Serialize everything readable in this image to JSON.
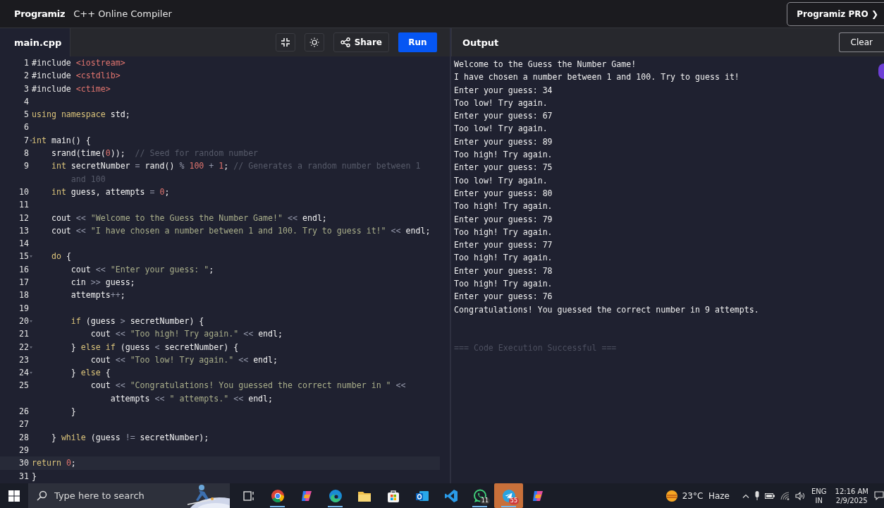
{
  "header": {
    "logo": "Programiz",
    "title": "C++ Online Compiler",
    "pro_button": "Programiz PRO ❯"
  },
  "editor": {
    "file_tab": "main.cpp",
    "share_button": "Share",
    "run_button": "Run",
    "lines": [
      {
        "n": "1",
        "fold": false,
        "active": false,
        "tokens": [
          {
            "kind": "pp",
            "text": "#include "
          },
          {
            "kind": "hdr",
            "text": "<iostream>"
          }
        ]
      },
      {
        "n": "2",
        "fold": false,
        "active": false,
        "tokens": [
          {
            "kind": "pp",
            "text": "#include "
          },
          {
            "kind": "hdr",
            "text": "<cstdlib>"
          }
        ]
      },
      {
        "n": "3",
        "fold": false,
        "active": false,
        "tokens": [
          {
            "kind": "pp",
            "text": "#include "
          },
          {
            "kind": "hdr",
            "text": "<ctime>"
          }
        ]
      },
      {
        "n": "4",
        "fold": false,
        "active": false
      },
      {
        "n": "5",
        "fold": false,
        "active": false,
        "tokens": [
          {
            "kind": "kw",
            "text": "using namespace "
          },
          {
            "kind": "id",
            "text": "std;"
          }
        ]
      },
      {
        "n": "6",
        "fold": false,
        "active": false
      },
      {
        "n": "7",
        "fold": true,
        "active": false,
        "tokens": [
          {
            "kind": "kw",
            "text": "int "
          },
          {
            "kind": "id",
            "text": "main() {"
          }
        ]
      },
      {
        "n": "8",
        "fold": false,
        "active": false,
        "tokens": [
          {
            "kind": "id",
            "text": "    srand(time("
          },
          {
            "kind": "num",
            "text": "0"
          },
          {
            "kind": "id",
            "text": "));  "
          },
          {
            "kind": "cmt",
            "text": "// Seed for random number"
          }
        ]
      },
      {
        "n": "9",
        "fold": false,
        "active": false,
        "tokens": [
          {
            "kind": "kw",
            "text": "    int "
          },
          {
            "kind": "id",
            "text": "secretNumber "
          },
          {
            "kind": "op",
            "text": "= "
          },
          {
            "kind": "id",
            "text": "rand() "
          },
          {
            "kind": "op",
            "text": "% "
          },
          {
            "kind": "num",
            "text": "100 "
          },
          {
            "kind": "op",
            "text": "+ "
          },
          {
            "kind": "num",
            "text": "1"
          },
          {
            "kind": "id",
            "text": "; "
          },
          {
            "kind": "cmt",
            "text": "// Generates a random number between 1"
          },
          {
            "kind": "wrap"
          },
          {
            "kind": "cmt",
            "text": "and 100"
          }
        ]
      },
      {
        "n": "10",
        "fold": false,
        "active": false,
        "tokens": [
          {
            "kind": "kw",
            "text": "    int "
          },
          {
            "kind": "id",
            "text": "guess, attempts "
          },
          {
            "kind": "op",
            "text": "= "
          },
          {
            "kind": "num",
            "text": "0"
          },
          {
            "kind": "id",
            "text": ";"
          }
        ]
      },
      {
        "n": "11",
        "fold": false,
        "active": false
      },
      {
        "n": "12",
        "fold": false,
        "active": false,
        "tokens": [
          {
            "kind": "id",
            "text": "    cout "
          },
          {
            "kind": "op",
            "text": "<< "
          },
          {
            "kind": "str",
            "text": "\"Welcome to the Guess the Number Game!\" "
          },
          {
            "kind": "op",
            "text": "<< "
          },
          {
            "kind": "id",
            "text": "endl;"
          }
        ]
      },
      {
        "n": "13",
        "fold": false,
        "active": false,
        "tokens": [
          {
            "kind": "id",
            "text": "    cout "
          },
          {
            "kind": "op",
            "text": "<< "
          },
          {
            "kind": "str",
            "text": "\"I have chosen a number between 1 and 100. Try to guess it!\" "
          },
          {
            "kind": "op",
            "text": "<< "
          },
          {
            "kind": "id",
            "text": "endl;"
          }
        ]
      },
      {
        "n": "14",
        "fold": false,
        "active": false
      },
      {
        "n": "15",
        "fold": true,
        "active": false,
        "tokens": [
          {
            "kind": "kw",
            "text": "    do "
          },
          {
            "kind": "id",
            "text": "{"
          }
        ]
      },
      {
        "n": "16",
        "fold": false,
        "active": false,
        "tokens": [
          {
            "kind": "id",
            "text": "        cout "
          },
          {
            "kind": "op",
            "text": "<< "
          },
          {
            "kind": "str",
            "text": "\"Enter your guess: \""
          },
          {
            "kind": "id",
            "text": ";"
          }
        ]
      },
      {
        "n": "17",
        "fold": false,
        "active": false,
        "tokens": [
          {
            "kind": "id",
            "text": "        cin "
          },
          {
            "kind": "op",
            "text": ">> "
          },
          {
            "kind": "id",
            "text": "guess;"
          }
        ]
      },
      {
        "n": "18",
        "fold": false,
        "active": false,
        "tokens": [
          {
            "kind": "id",
            "text": "        attempts"
          },
          {
            "kind": "op",
            "text": "++"
          },
          {
            "kind": "id",
            "text": ";"
          }
        ]
      },
      {
        "n": "19",
        "fold": false,
        "active": false
      },
      {
        "n": "20",
        "fold": true,
        "active": false,
        "tokens": [
          {
            "kind": "kw",
            "text": "        if "
          },
          {
            "kind": "id",
            "text": "(guess "
          },
          {
            "kind": "op",
            "text": "> "
          },
          {
            "kind": "id",
            "text": "secretNumber) {"
          }
        ]
      },
      {
        "n": "21",
        "fold": false,
        "active": false,
        "tokens": [
          {
            "kind": "id",
            "text": "            cout "
          },
          {
            "kind": "op",
            "text": "<< "
          },
          {
            "kind": "str",
            "text": "\"Too high! Try again.\" "
          },
          {
            "kind": "op",
            "text": "<< "
          },
          {
            "kind": "id",
            "text": "endl;"
          }
        ]
      },
      {
        "n": "22",
        "fold": true,
        "active": false,
        "tokens": [
          {
            "kind": "id",
            "text": "        } "
          },
          {
            "kind": "kw",
            "text": "else if "
          },
          {
            "kind": "id",
            "text": "(guess "
          },
          {
            "kind": "op",
            "text": "< "
          },
          {
            "kind": "id",
            "text": "secretNumber) {"
          }
        ]
      },
      {
        "n": "23",
        "fold": false,
        "active": false,
        "tokens": [
          {
            "kind": "id",
            "text": "            cout "
          },
          {
            "kind": "op",
            "text": "<< "
          },
          {
            "kind": "str",
            "text": "\"Too low! Try again.\" "
          },
          {
            "kind": "op",
            "text": "<< "
          },
          {
            "kind": "id",
            "text": "endl;"
          }
        ]
      },
      {
        "n": "24",
        "fold": true,
        "active": false,
        "tokens": [
          {
            "kind": "id",
            "text": "        } "
          },
          {
            "kind": "kw",
            "text": "else "
          },
          {
            "kind": "id",
            "text": "{"
          }
        ]
      },
      {
        "n": "25",
        "fold": false,
        "active": false,
        "tokens": [
          {
            "kind": "id",
            "text": "            cout "
          },
          {
            "kind": "op",
            "text": "<< "
          },
          {
            "kind": "str",
            "text": "\"Congratulations! You guessed the correct number in \" "
          },
          {
            "kind": "op",
            "text": "<<"
          },
          {
            "kind": "wrap"
          },
          {
            "kind": "id",
            "text": "attempts "
          },
          {
            "kind": "op",
            "text": "<< "
          },
          {
            "kind": "str",
            "text": "\" attempts.\" "
          },
          {
            "kind": "op",
            "text": "<< "
          },
          {
            "kind": "id",
            "text": "endl;"
          }
        ]
      },
      {
        "n": "26",
        "fold": false,
        "active": false,
        "tokens": [
          {
            "kind": "id",
            "text": "        }"
          }
        ]
      },
      {
        "n": "27",
        "fold": false,
        "active": false
      },
      {
        "n": "28",
        "fold": false,
        "active": false,
        "tokens": [
          {
            "kind": "id",
            "text": "    } "
          },
          {
            "kind": "kw",
            "text": "while "
          },
          {
            "kind": "id",
            "text": "(guess "
          },
          {
            "kind": "op",
            "text": "!= "
          },
          {
            "kind": "id",
            "text": "secretNumber);"
          }
        ]
      },
      {
        "n": "29",
        "fold": false,
        "active": false
      },
      {
        "n": "30",
        "fold": false,
        "active": true,
        "tokens": [
          {
            "kind": "kw",
            "text": "return "
          },
          {
            "kind": "num",
            "text": "0"
          },
          {
            "kind": "id",
            "text": ";"
          }
        ]
      },
      {
        "n": "31",
        "fold": false,
        "active": false,
        "tokens": [
          {
            "kind": "id",
            "text": "}"
          }
        ]
      }
    ]
  },
  "output": {
    "title": "Output",
    "clear_button": "Clear",
    "lines": [
      "Welcome to the Guess the Number Game!",
      "I have chosen a number between 1 and 100. Try to guess it!",
      "Enter your guess: 34",
      "Too low! Try again.",
      "Enter your guess: 67",
      "Too low! Try again.",
      "Enter your guess: 89",
      "Too high! Try again.",
      "Enter your guess: 75",
      "Too low! Try again.",
      "Enter your guess: 80",
      "Too high! Try again.",
      "Enter your guess: 79",
      "Too high! Try again.",
      "Enter your guess: 77",
      "Too high! Try again.",
      "Enter your guess: 78",
      "Too high! Try again.",
      "Enter your guess: 76",
      "Congratulations! You guessed the correct number in 9 attempts."
    ],
    "status": "=== Code Execution Successful ==="
  },
  "taskbar": {
    "search_placeholder": "Type here to search",
    "apps": [
      {
        "kind": "taskview",
        "running": false,
        "selected": false
      },
      {
        "kind": "chrome",
        "running": true,
        "selected": false
      },
      {
        "kind": "copilot",
        "running": false,
        "selected": false
      },
      {
        "kind": "edge",
        "running": true,
        "selected": false
      },
      {
        "kind": "folder",
        "running": false,
        "selected": false
      },
      {
        "kind": "store",
        "running": false,
        "selected": false
      },
      {
        "kind": "outlook",
        "running": false,
        "selected": false
      },
      {
        "kind": "vscode",
        "running": false,
        "selected": false
      },
      {
        "kind": "whatsapp",
        "running": true,
        "selected": false,
        "badge": "11"
      },
      {
        "kind": "telegram",
        "running": true,
        "selected": true,
        "badge": "55"
      },
      {
        "kind": "copilot",
        "running": false,
        "selected": false
      }
    ],
    "weather": "23°C  Haze",
    "lang": "ENG",
    "region": "IN",
    "time": "12:16 AM",
    "date": "2/9/2025"
  }
}
